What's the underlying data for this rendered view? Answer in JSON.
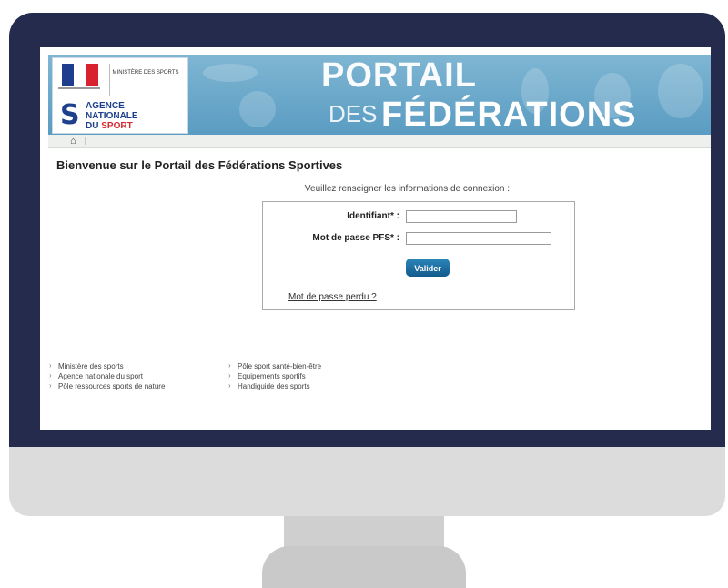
{
  "banner": {
    "ministry_text": "MINISTÈRE DES SPORTS",
    "agency_line1": "AGENCE",
    "agency_line2": "NATIONALE",
    "agency_line3_prefix": "DU",
    "agency_line3_highlight": "SPORT",
    "portal_title_line1": "PORTAIL",
    "portal_title_des": "DES",
    "portal_title_line2": "FÉDÉRATIONS"
  },
  "nav": {
    "home_icon": "home-icon"
  },
  "page": {
    "title": "Bienvenue sur le Portail des Fédérations Sportives",
    "subtitle": "Veuillez renseigner les informations de connexion :"
  },
  "login": {
    "identifiant_label": "Identifiant* :",
    "identifiant_value": "",
    "password_label": "Mot de passe PFS* :",
    "password_value": "",
    "submit_label": "Valider",
    "lost_password_link": "Mot de passe perdu ?"
  },
  "footer": {
    "col1": [
      "Ministère des sports",
      "Agence nationale du sport",
      "Pôle ressources sports de nature"
    ],
    "col2": [
      "Pôle sport santé-bien-être",
      "Equipements sportifs",
      "Handiguide des sports"
    ]
  },
  "colors": {
    "bezel": "#252b4d",
    "banner": "#6aa7c9",
    "button": "#135a8c",
    "agency_blue": "#1d3f8c",
    "agency_red": "#d32b34"
  }
}
